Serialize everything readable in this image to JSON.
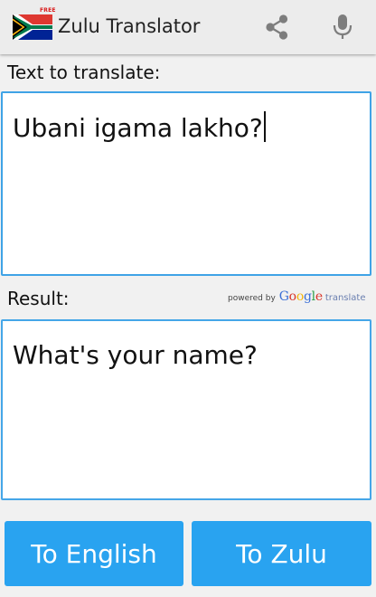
{
  "app": {
    "title": "Zulu Translator",
    "badge": "FREE",
    "accent_color": "#29a3f0",
    "icons": {
      "flag": "south-africa-flag-icon",
      "share": "share-icon",
      "mic": "microphone-icon"
    }
  },
  "input": {
    "label": "Text to translate:",
    "value": "Ubani igama lakho?"
  },
  "result": {
    "label": "Result:",
    "value": "What's your name?"
  },
  "powered_by": {
    "prefix": "powered by",
    "brand_letters": [
      {
        "ch": "G",
        "color": "#3b6fd6"
      },
      {
        "ch": "o",
        "color": "#d8352a"
      },
      {
        "ch": "o",
        "color": "#f2b50f"
      },
      {
        "ch": "g",
        "color": "#3b6fd6"
      },
      {
        "ch": "l",
        "color": "#2c9e48"
      },
      {
        "ch": "e",
        "color": "#d8352a"
      }
    ],
    "suffix": "translate"
  },
  "buttons": {
    "to_english": "To English",
    "to_zulu": "To Zulu"
  }
}
